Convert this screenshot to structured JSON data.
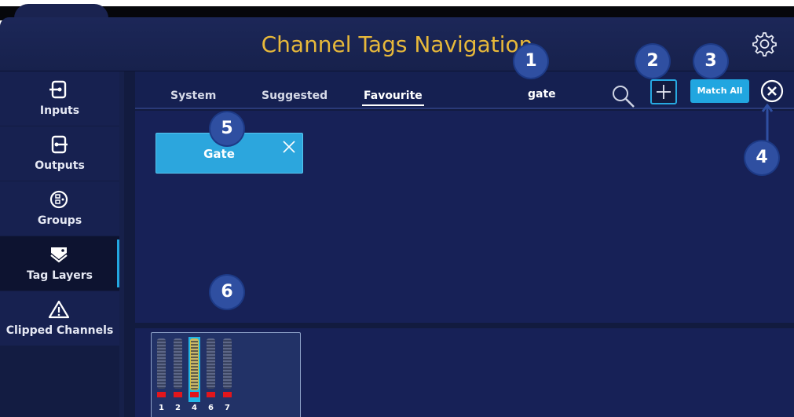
{
  "header": {
    "title": "Channel Tags Navigation"
  },
  "sidebar": {
    "items": [
      {
        "label": "Inputs",
        "icon": "input-icon"
      },
      {
        "label": "Outputs",
        "icon": "output-icon"
      },
      {
        "label": "Groups",
        "icon": "groups-icon"
      },
      {
        "label": "Tag Layers",
        "icon": "tag-icon",
        "active": true
      },
      {
        "label": "Clipped Channels",
        "icon": "warning-icon"
      }
    ]
  },
  "tabs": {
    "system": "System",
    "suggested": "Suggested",
    "favourite": "Favourite"
  },
  "toolbar": {
    "search_value": "gate",
    "match_all": "Match All"
  },
  "chips": [
    {
      "label": "Gate"
    }
  ],
  "channels": {
    "numbers": [
      "1",
      "2",
      "4",
      "6",
      "7"
    ],
    "selected_index": 2
  },
  "badges": [
    "1",
    "2",
    "3",
    "4",
    "5",
    "6"
  ],
  "colors": {
    "title": "#e8b93a",
    "accent": "#21a6e0",
    "badge": "#2f4fa1",
    "clip": "#e2161c"
  }
}
